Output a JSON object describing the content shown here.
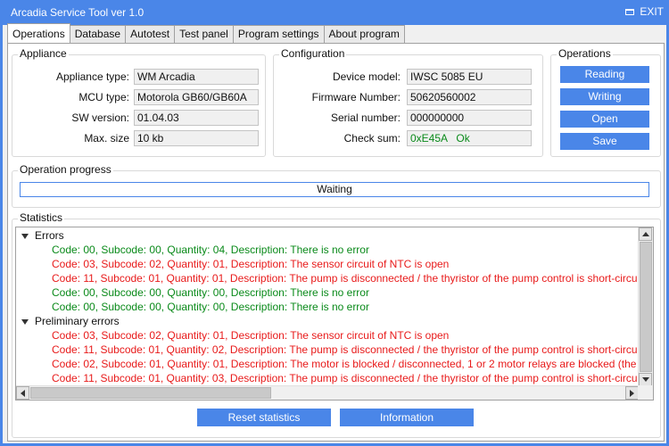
{
  "window": {
    "title": "Arcadia Service Tool ver 1.0",
    "exit_label": "EXIT",
    "accent_color": "#4a86e8"
  },
  "tabs": [
    {
      "label": "Operations",
      "active": true
    },
    {
      "label": "Database"
    },
    {
      "label": "Autotest"
    },
    {
      "label": "Test panel"
    },
    {
      "label": "Program settings"
    },
    {
      "label": "About program"
    }
  ],
  "appliance": {
    "title": "Appliance",
    "fields": [
      {
        "label": "Appliance type:",
        "value": "WM Arcadia"
      },
      {
        "label": "MCU type:",
        "value": "Motorola GB60/GB60A"
      },
      {
        "label": "SW version:",
        "value": "01.04.03"
      },
      {
        "label": "Max. size",
        "value": "10 kb"
      }
    ]
  },
  "configuration": {
    "title": "Configuration",
    "fields": [
      {
        "label": "Device model:",
        "value": "IWSC 5085 EU"
      },
      {
        "label": "Firmware Number:",
        "value": "50620560002"
      },
      {
        "label": "Serial number:",
        "value": "000000000"
      },
      {
        "label": "Check sum:",
        "value": "0xE45A   Ok"
      }
    ]
  },
  "operations": {
    "title": "Operations",
    "buttons": [
      "Reading",
      "Writing",
      "Open",
      "Save"
    ]
  },
  "progress": {
    "title": "Operation progress",
    "status": "Waiting",
    "fraction": 0
  },
  "statistics": {
    "title": "Statistics",
    "errors_label": "Errors",
    "errors": [
      {
        "text": "Code: 00, Subcode: 00, Quantity: 04, Description: There is no error",
        "color": "green"
      },
      {
        "text": "Code: 03, Subcode: 02, Quantity: 01, Description: The sensor circuit of NTC is open",
        "color": "red"
      },
      {
        "text": "Code: 11, Subcode: 01, Quantity: 01, Description: The pump is disconnected / the thyristor of the pump control is short-circu",
        "color": "red"
      },
      {
        "text": "Code: 00, Subcode: 00, Quantity: 00, Description: There is no error",
        "color": "green"
      },
      {
        "text": "Code: 00, Subcode: 00, Quantity: 00, Description: There is no error",
        "color": "green"
      }
    ],
    "preliminary_label": "Preliminary errors",
    "preliminary": [
      {
        "text": "Code: 03, Subcode: 02, Quantity: 01, Description: The sensor circuit of NTC is open",
        "color": "red"
      },
      {
        "text": "Code: 11, Subcode: 01, Quantity: 02, Description: The pump is disconnected / the thyristor of the pump control is short-circu",
        "color": "red"
      },
      {
        "text": "Code: 02, Subcode: 01, Quantity: 01, Description: The motor is blocked / disconnected, 1 or 2 motor relays are blocked (the c",
        "color": "red"
      },
      {
        "text": "Code: 11, Subcode: 01, Quantity: 03, Description: The pump is disconnected / the thyristor of the pump control is short-circu",
        "color": "red"
      }
    ],
    "reset_label": "Reset statistics",
    "info_label": "Information"
  }
}
